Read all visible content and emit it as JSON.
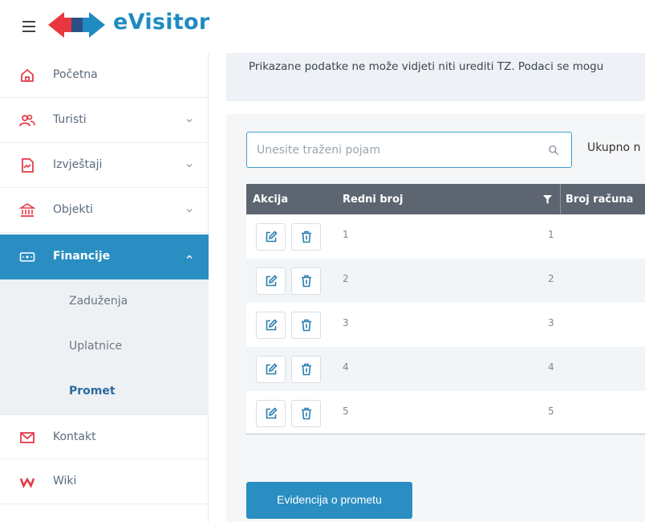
{
  "app": {
    "logo_text": "eVisitor"
  },
  "sidebar": {
    "items": [
      {
        "label": "Početna",
        "icon": "home-icon"
      },
      {
        "label": "Turisti",
        "icon": "users-icon"
      },
      {
        "label": "Izvještaji",
        "icon": "report-icon"
      },
      {
        "label": "Objekti",
        "icon": "building-icon"
      },
      {
        "label": "Financije",
        "icon": "money-icon"
      },
      {
        "label": "Kontakt",
        "icon": "mail-icon"
      },
      {
        "label": "Wiki",
        "icon": "wiki-icon"
      }
    ],
    "subitems": [
      {
        "label": "Zaduženja"
      },
      {
        "label": "Uplatnice"
      },
      {
        "label": "Promet"
      }
    ]
  },
  "main": {
    "notice": "Prikazane podatke ne može vidjeti niti urediti TZ. Podaci se mogu",
    "search": {
      "placeholder": "Unesite traženi pojam"
    },
    "total_label": "Ukupno n",
    "table": {
      "headers": {
        "action": "Akcija",
        "ordinal": "Redni broj",
        "invoice": "Broj računa"
      },
      "rows": [
        {
          "redni_broj": "1",
          "broj_racuna": "1"
        },
        {
          "redni_broj": "2",
          "broj_racuna": "2"
        },
        {
          "redni_broj": "3",
          "broj_racuna": "3"
        },
        {
          "redni_broj": "4",
          "broj_racuna": "4"
        },
        {
          "redni_broj": "5",
          "broj_racuna": "5"
        }
      ]
    },
    "action_button": "Evidencija o prometu"
  },
  "colors": {
    "accent": "#2a8ec3",
    "logo_red": "#e8373e",
    "table_header": "#5c6570"
  }
}
